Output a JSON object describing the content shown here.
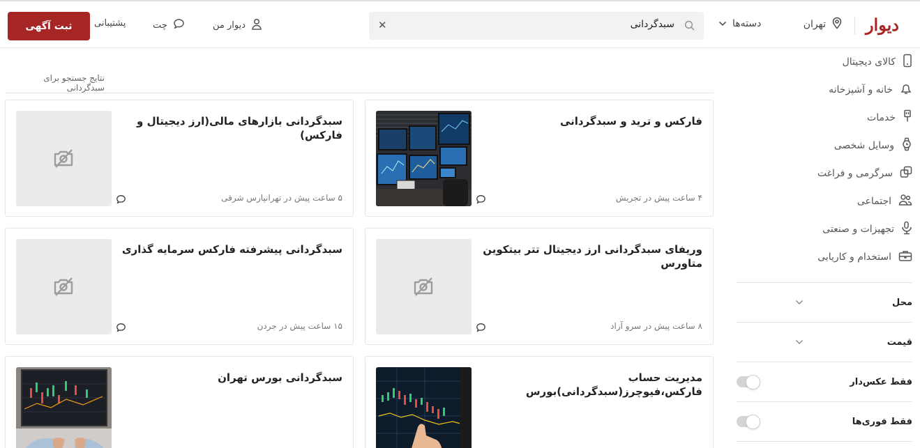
{
  "header": {
    "logo": "دیوار",
    "city": "تهران",
    "categories_label": "دسته‌ها",
    "search_value": "سبدگردانی",
    "nav": {
      "my_divar": "دیوار من",
      "chat": "چت",
      "support": "پشتیبانی"
    },
    "post_button": "ثبت آگهی"
  },
  "sidebar": {
    "categories": [
      {
        "label": "کالای دیجیتال",
        "icon": "mobile-icon"
      },
      {
        "label": "خانه و آشپزخانه",
        "icon": "lamp-icon"
      },
      {
        "label": "خدمات",
        "icon": "brush-icon"
      },
      {
        "label": "وسایل شخصی",
        "icon": "watch-icon"
      },
      {
        "label": "سرگرمی و فراغت",
        "icon": "games-icon"
      },
      {
        "label": "اجتماعی",
        "icon": "people-icon"
      },
      {
        "label": "تجهیزات و صنعتی",
        "icon": "microscope-icon"
      },
      {
        "label": "استخدام و کاریابی",
        "icon": "briefcase-icon"
      }
    ],
    "filters": {
      "location": "محل",
      "price": "قیمت",
      "photo_only": "فقط عکس‌دار",
      "urgent_only": "فقط فوری‌ها"
    }
  },
  "results_label": "نتایج جستجو برای سبدگردانی",
  "listings": [
    {
      "title": "فارکس و ترید و سبدگردانی",
      "meta": "۴ ساعت پیش در تجریش",
      "has_image": true,
      "image": "trading-desk"
    },
    {
      "title": "سبدگردانی بازارهای مالی(ارز دیجیتال و فارکس)",
      "meta": "۵ ساعت پیش در تهرانپارس شرقی",
      "has_image": false
    },
    {
      "title": "وریفای سبدگردانی ارز دیجیتال تتر بیتکوین متاورس",
      "meta": "۸ ساعت پیش در سرو آزاد",
      "has_image": false
    },
    {
      "title": "سبدگردانی پیشرفته فارکس سرمایه گذاری",
      "meta": "۱۵ ساعت پیش در جردن",
      "has_image": false
    },
    {
      "title": "مدیریت حساب فارکس،فیوچرز(سبدگردانی)بورس",
      "meta": "",
      "has_image": true,
      "image": "chart-screen"
    },
    {
      "title": "سبدگردانی بورس تهران",
      "meta": "",
      "has_image": true,
      "image": "laptop-chart"
    }
  ]
}
